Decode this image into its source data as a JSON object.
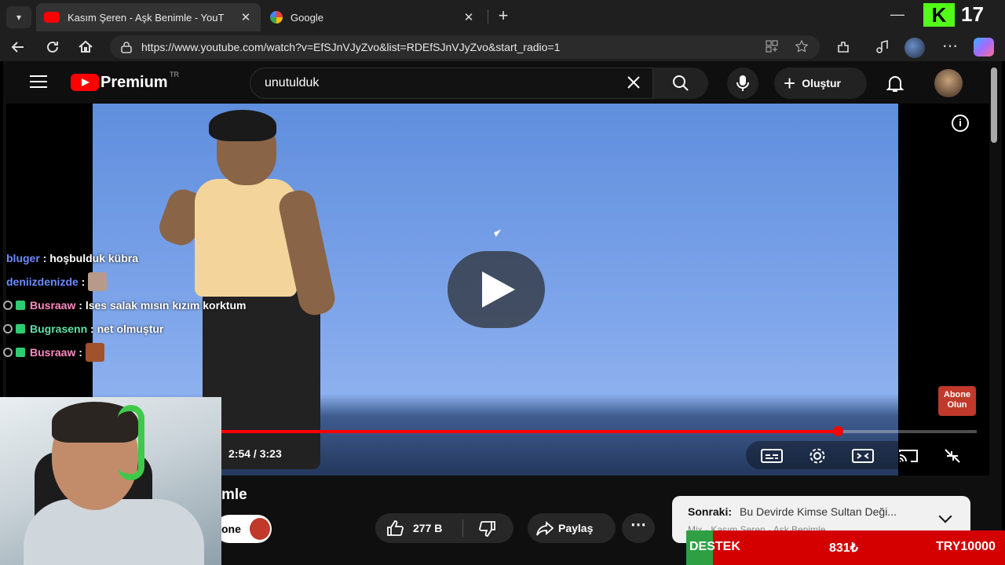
{
  "browser": {
    "tabs": [
      {
        "title": "Kasım Şeren - Aşk Benimle - YouT",
        "active": true,
        "favicon": "youtube-favicon"
      },
      {
        "title": "Google",
        "active": false,
        "favicon": "google-favicon"
      }
    ],
    "url": "https://www.youtube.com/watch?v=EfSJnVJyZvo&list=RDEfSJnVJyZvo&start_radio=1",
    "close_glyph": "✕",
    "new_tab_glyph": "+",
    "minimize_glyph": "—"
  },
  "stream": {
    "viewer_logo": "K",
    "viewer_count": "17",
    "brand_color": "#53fc18",
    "chat": [
      {
        "user": "bluger",
        "color": "#6b8cff",
        "message": "hoşbulduk kübra",
        "badges": false,
        "emote": false
      },
      {
        "user": "deniizdenizde",
        "color": "#6b8cff",
        "message": "",
        "badges": false,
        "emote": true
      },
      {
        "user": "Busraaw",
        "color": "#ff8ac2",
        "message": "lses salak mısın kızım korktum",
        "badges": true,
        "emote": false
      },
      {
        "user": "Bugrasenn",
        "color": "#5fe0a8",
        "message": "net olmuştur",
        "badges": true,
        "emote": false
      },
      {
        "user": "Busraaw",
        "color": "#ff8ac2",
        "message": "",
        "badges": true,
        "emote": true
      }
    ],
    "destek": {
      "label": "DESTEK",
      "amount": "831₺",
      "goal": "TRY10000"
    }
  },
  "youtube": {
    "brand": "Premium",
    "country": "TR",
    "search_query": "unutulduk",
    "create_label": "Oluştur",
    "player": {
      "current_time": "2:54",
      "duration": "3:23",
      "progress": 0.857,
      "abone_badge": "Abone Olun",
      "info_glyph": "i"
    },
    "video_title_fragment": "mle",
    "channel_fragment": "one",
    "likes": "277 B",
    "share_label": "Paylaş",
    "more_glyph": "⋯",
    "next": {
      "label": "Sonraki:",
      "title": "Bu Devirde Kimse Sultan Deği...",
      "subtitle": "Mix - Kasım Şeren - Aşk Benimle"
    }
  }
}
